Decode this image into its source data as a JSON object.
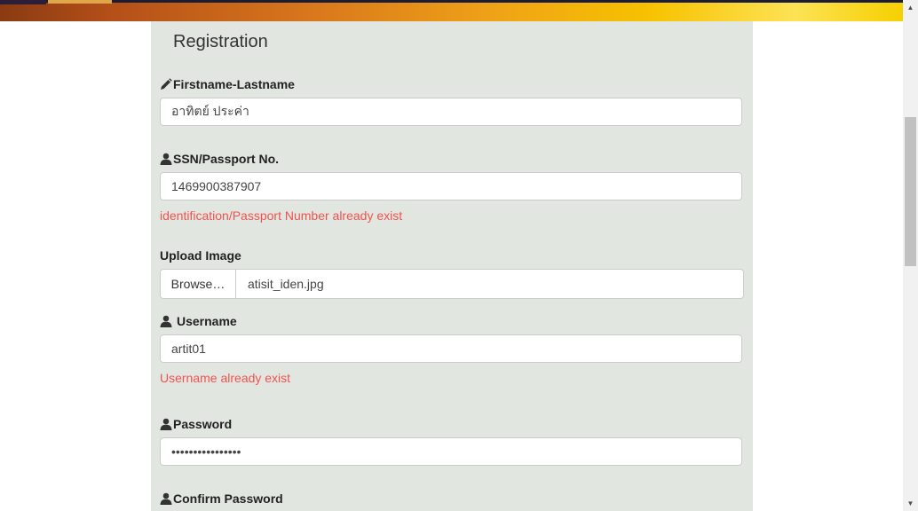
{
  "form": {
    "title": "Registration",
    "fullname": {
      "label": "Firstname-Lastname",
      "value": "อาทิตย์ ประค่า",
      "icon": "pencil-icon"
    },
    "ssn": {
      "label": "SSN/Passport No.",
      "value": "1469900387907",
      "error": "identification/Passport Number already exist",
      "icon": "user-icon"
    },
    "upload": {
      "label": "Upload Image",
      "button": "Browse…",
      "filename": "atisit_iden.jpg"
    },
    "username": {
      "label": "Username",
      "value": "artit01",
      "error": "Username already exist",
      "icon": "user-icon"
    },
    "password": {
      "label": "Password",
      "value": "••••••••••••••••",
      "icon": "user-icon"
    },
    "confirm_password": {
      "label": "Confirm Password",
      "icon": "user-icon"
    }
  },
  "colors": {
    "error": "#ef5350",
    "panel": "#e2e6e1"
  }
}
